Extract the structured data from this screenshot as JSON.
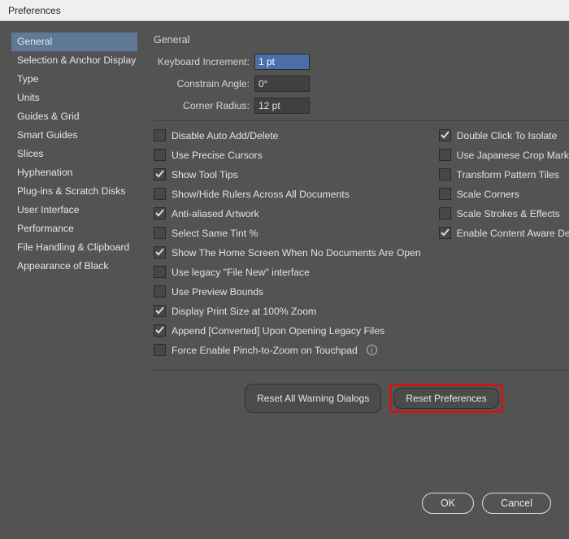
{
  "window": {
    "title": "Preferences"
  },
  "sidebar": {
    "items": [
      {
        "label": "General",
        "selected": true
      },
      {
        "label": "Selection & Anchor Display",
        "selected": false
      },
      {
        "label": "Type",
        "selected": false
      },
      {
        "label": "Units",
        "selected": false
      },
      {
        "label": "Guides & Grid",
        "selected": false
      },
      {
        "label": "Smart Guides",
        "selected": false
      },
      {
        "label": "Slices",
        "selected": false
      },
      {
        "label": "Hyphenation",
        "selected": false
      },
      {
        "label": "Plug-ins & Scratch Disks",
        "selected": false
      },
      {
        "label": "User Interface",
        "selected": false
      },
      {
        "label": "Performance",
        "selected": false
      },
      {
        "label": "File Handling & Clipboard",
        "selected": false
      },
      {
        "label": "Appearance of Black",
        "selected": false
      }
    ]
  },
  "panel": {
    "title": "General",
    "fields": {
      "keyboardIncrement": {
        "label": "Keyboard Increment:",
        "value": "1 pt"
      },
      "constrainAngle": {
        "label": "Constrain Angle:",
        "value": "0°"
      },
      "cornerRadius": {
        "label": "Corner Radius:",
        "value": "12 pt"
      }
    },
    "checksLeft": [
      {
        "label": "Disable Auto Add/Delete",
        "checked": false
      },
      {
        "label": "Use Precise Cursors",
        "checked": false
      },
      {
        "label": "Show Tool Tips",
        "checked": true
      },
      {
        "label": "Show/Hide Rulers Across All Documents",
        "checked": false
      },
      {
        "label": "Anti-aliased Artwork",
        "checked": true
      },
      {
        "label": "Select Same Tint %",
        "checked": false
      },
      {
        "label": "Show The Home Screen When No Documents Are Open",
        "checked": true
      },
      {
        "label": "Use legacy \"File New\" interface",
        "checked": false
      },
      {
        "label": "Use Preview Bounds",
        "checked": false
      },
      {
        "label": "Display Print Size at 100% Zoom",
        "checked": true
      },
      {
        "label": "Append [Converted] Upon Opening Legacy Files",
        "checked": true
      },
      {
        "label": "Force Enable Pinch-to-Zoom on Touchpad",
        "checked": false,
        "info": true
      }
    ],
    "checksRight": [
      {
        "label": "Double Click To Isolate",
        "checked": true
      },
      {
        "label": "Use Japanese Crop Marks",
        "checked": false
      },
      {
        "label": "Transform Pattern Tiles",
        "checked": false
      },
      {
        "label": "Scale Corners",
        "checked": false
      },
      {
        "label": "Scale Strokes & Effects",
        "checked": false
      },
      {
        "label": "Enable Content Aware Defaults",
        "checked": true
      }
    ],
    "buttons": {
      "resetWarnings": "Reset All Warning Dialogs",
      "resetPrefs": "Reset Preferences"
    }
  },
  "footer": {
    "ok": "OK",
    "cancel": "Cancel"
  }
}
